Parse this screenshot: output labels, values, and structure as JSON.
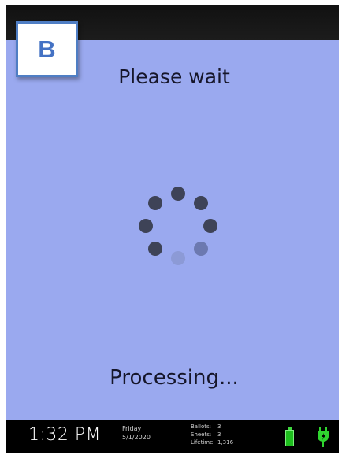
{
  "badge": {
    "letter": "B"
  },
  "screen": {
    "title": "Please wait",
    "status": "Processing...",
    "background_color": "#9aa9ef"
  },
  "spinner": {
    "dot_colors": [
      "#3e4357",
      "#3e4357",
      "#3e4357",
      "#6c79b0",
      "#8c9ad6",
      "#3e4357",
      "#3e4357",
      "#3e4357"
    ]
  },
  "status_bar": {
    "time": "1:32 PM",
    "day": "Friday",
    "date": "5/1/2020",
    "ballots_label": "Ballots:",
    "ballots_value": "3",
    "sheets_label": "Sheets:",
    "sheets_value": "3",
    "lifetime_label": "Lifetime:",
    "lifetime_value": "1,316",
    "battery_icon": "battery-full-icon",
    "power_icon": "power-plug-icon",
    "accent_color": "#1ebf1e"
  }
}
